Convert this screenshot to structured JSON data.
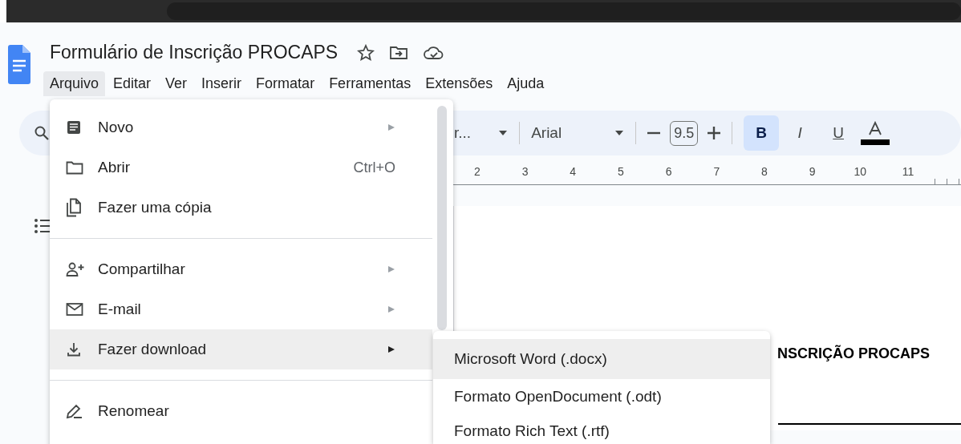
{
  "document": {
    "title": "Formulário de Inscrição PROCAPS"
  },
  "menubar": [
    {
      "label": "Arquivo",
      "selected": true
    },
    {
      "label": "Editar",
      "selected": false
    },
    {
      "label": "Ver",
      "selected": false
    },
    {
      "label": "Inserir",
      "selected": false
    },
    {
      "label": "Formatar",
      "selected": false
    },
    {
      "label": "Ferramentas",
      "selected": false
    },
    {
      "label": "Extensões",
      "selected": false
    },
    {
      "label": "Ajuda",
      "selected": false
    }
  ],
  "toolbar": {
    "style": "r...",
    "font": "Arial",
    "font_size": "9.5",
    "format_buttons": [
      {
        "label": "B",
        "selected": true
      },
      {
        "label": "I",
        "selected": false
      },
      {
        "label": "U",
        "selected": false
      }
    ]
  },
  "ruler": [
    "2",
    "3",
    "4",
    "5",
    "6",
    "7",
    "8",
    "9",
    "10",
    "11"
  ],
  "file_menu": [
    {
      "kind": "item",
      "label": "Novo",
      "submenu": true,
      "selected": false
    },
    {
      "kind": "item",
      "label": "Abrir",
      "shortcut": "Ctrl+O",
      "submenu": false,
      "selected": false
    },
    {
      "kind": "item",
      "label": "Fazer uma cópia",
      "submenu": false,
      "selected": false
    },
    {
      "kind": "separator"
    },
    {
      "kind": "item",
      "label": "Compartilhar",
      "submenu": true,
      "selected": false
    },
    {
      "kind": "item",
      "label": "E-mail",
      "submenu": true,
      "selected": false
    },
    {
      "kind": "item",
      "label": "Fazer download",
      "submenu": true,
      "selected": true
    },
    {
      "kind": "separator"
    },
    {
      "kind": "item",
      "label": "Renomear",
      "submenu": false,
      "selected": false
    }
  ],
  "download_menu": [
    {
      "label": "Microsoft Word (.docx)",
      "selected": true
    },
    {
      "label": "Formato OpenDocument (.odt)",
      "selected": false
    },
    {
      "label": "Formato Rich Text (.rtf)",
      "selected": false
    }
  ],
  "page": {
    "heading": "NSCRIÇÃO PROCAPS"
  }
}
